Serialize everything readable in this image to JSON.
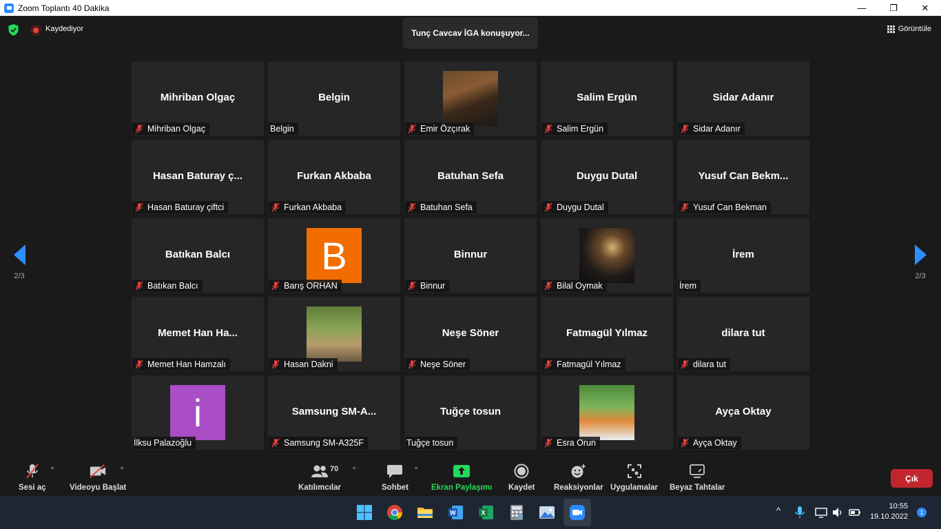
{
  "window": {
    "title": "Zoom Toplantı 40 Dakika",
    "minimize": "—",
    "maximize": "❐",
    "close": "✕"
  },
  "topbar": {
    "recording_label": "Kaydediyor",
    "speaker_banner": "Tunç Cavcav İGA konuşuyor...",
    "view_label": "Görüntüle"
  },
  "gallery": {
    "page_left": "2/3",
    "page_right": "2/3",
    "tiles": [
      {
        "display_name": "Mihriban Olgaç",
        "tag": "Mihriban Olgaç",
        "muted": true,
        "avatar": "none"
      },
      {
        "display_name": "Belgin",
        "tag": "Belgin",
        "muted": false,
        "avatar": "none"
      },
      {
        "display_name": "",
        "tag": "Emir Özçırak",
        "muted": true,
        "avatar": "photo1"
      },
      {
        "display_name": "Salim Ergün",
        "tag": "Salim Ergün",
        "muted": true,
        "avatar": "none"
      },
      {
        "display_name": "Sidar Adanır",
        "tag": "Sidar Adanır",
        "muted": true,
        "avatar": "none"
      },
      {
        "display_name": "Hasan Baturay ç...",
        "tag": "Hasan Baturay çiftci",
        "muted": true,
        "avatar": "none"
      },
      {
        "display_name": "Furkan Akbaba",
        "tag": "Furkan Akbaba",
        "muted": true,
        "avatar": "none"
      },
      {
        "display_name": "Batuhan Sefa",
        "tag": "Batuhan Sefa",
        "muted": true,
        "avatar": "none"
      },
      {
        "display_name": "Duygu Dutal",
        "tag": "Duygu Dutal",
        "muted": true,
        "avatar": "none"
      },
      {
        "display_name": "Yusuf Can Bekm...",
        "tag": "Yusuf Can Bekman",
        "muted": true,
        "avatar": "none"
      },
      {
        "display_name": "Batıkan Balcı",
        "tag": "Batıkan Balcı",
        "muted": true,
        "avatar": "none"
      },
      {
        "display_name": "",
        "tag": "Barış ORHAN",
        "muted": true,
        "avatar": "letter",
        "letter": "B",
        "color": "#f26d00"
      },
      {
        "display_name": "Binnur",
        "tag": "Binnur",
        "muted": true,
        "avatar": "none"
      },
      {
        "display_name": "",
        "tag": "Bilal Oymak",
        "muted": true,
        "avatar": "photo2"
      },
      {
        "display_name": "İrem",
        "tag": "İrem",
        "muted": false,
        "avatar": "none"
      },
      {
        "display_name": "Memet Han Ha...",
        "tag": "Memet Han Hamzalı",
        "muted": true,
        "avatar": "none"
      },
      {
        "display_name": "",
        "tag": "Hasan Dakni",
        "muted": true,
        "avatar": "photo3"
      },
      {
        "display_name": "Neşe Söner",
        "tag": "Neşe Söner",
        "muted": true,
        "avatar": "none"
      },
      {
        "display_name": "Fatmagül Yılmaz",
        "tag": "Fatmagül Yılmaz",
        "muted": true,
        "avatar": "none"
      },
      {
        "display_name": "dilara tut",
        "tag": "dilara tut",
        "muted": true,
        "avatar": "none"
      },
      {
        "display_name": "",
        "tag": "İlksu Palazoğlu",
        "muted": false,
        "avatar": "letter",
        "letter": "i",
        "color": "#a94ec4"
      },
      {
        "display_name": "Samsung SM-A...",
        "tag": "Samsung SM-A325F",
        "muted": true,
        "avatar": "none"
      },
      {
        "display_name": "Tuğçe tosun",
        "tag": "Tuğçe tosun",
        "muted": false,
        "avatar": "none"
      },
      {
        "display_name": "",
        "tag": "Esra Orun",
        "muted": true,
        "avatar": "photo4"
      },
      {
        "display_name": "Ayça Oktay",
        "tag": "Ayça Oktay",
        "muted": true,
        "avatar": "none"
      }
    ]
  },
  "toolbar": {
    "unmute_label": "Sesi aç",
    "video_label": "Videoyu Başlat",
    "participants_label": "Katılımcılar",
    "participants_count": "70",
    "chat_label": "Sohbet",
    "share_label": "Ekran Paylaşımı",
    "record_label": "Kaydet",
    "reactions_label": "Reaksiyonlar",
    "apps_label": "Uygulamalar",
    "whiteboard_label": "Beyaz Tahtalar",
    "exit_label": "Çık",
    "caret": "^"
  },
  "taskbar": {
    "time": "10:55",
    "date": "19.10.2022",
    "notifications": "1",
    "tray_caret": "^"
  },
  "colors": {
    "accent": "#2d8cff",
    "share_green": "#23d959",
    "exit_red": "#c1262f",
    "mute_red": "#e8423c"
  }
}
